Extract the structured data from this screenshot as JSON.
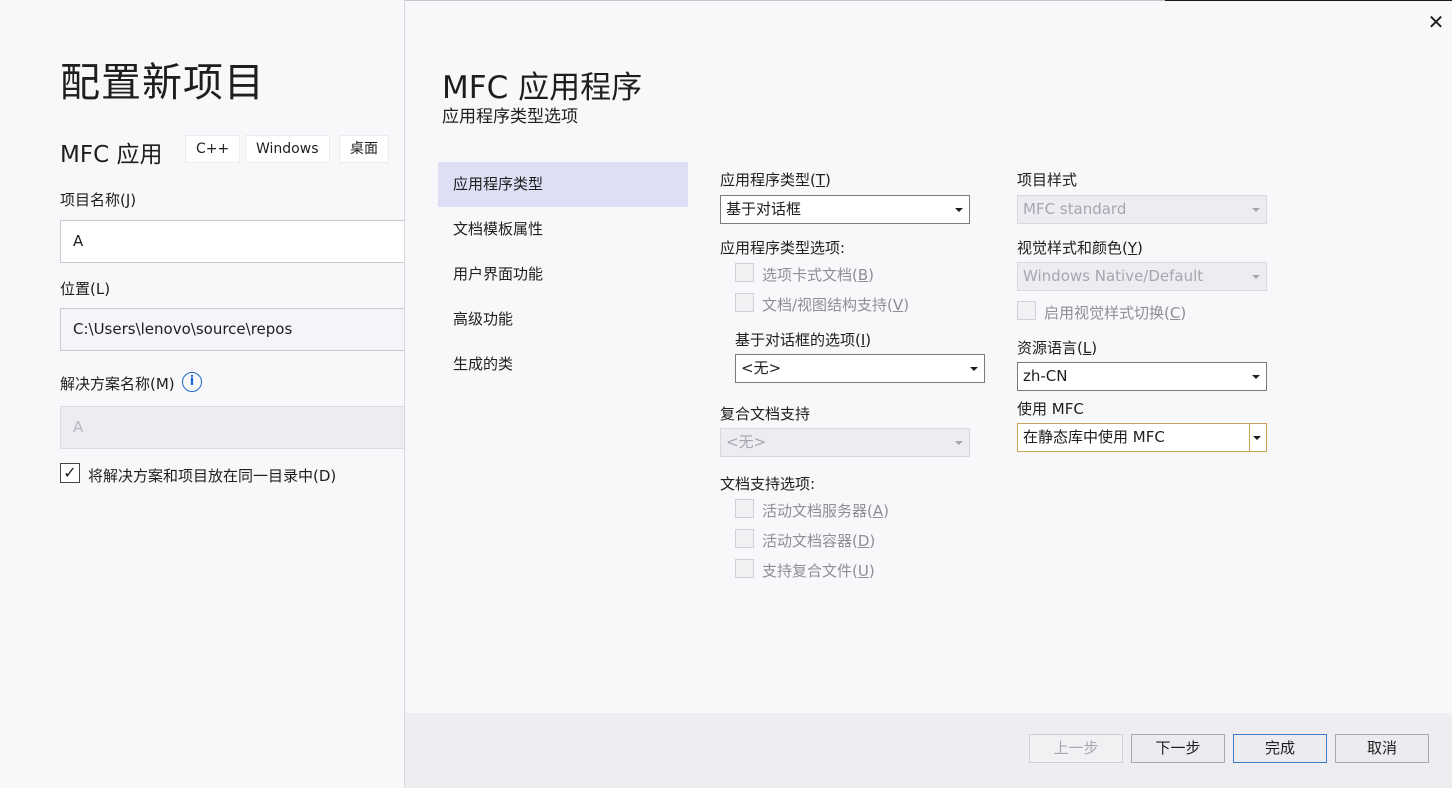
{
  "background": {
    "title": "配置新项目",
    "template_name": "MFC 应用",
    "tags": [
      "C++",
      "Windows",
      "桌面"
    ],
    "project_name_label": "项目名称(J)",
    "project_name_value": "A",
    "location_label": "位置(L)",
    "location_value": "C:\\Users\\lenovo\\source\\repos",
    "solution_name_label": "解决方案名称(M)",
    "solution_name_value": "A",
    "same_dir_label": "将解决方案和项目放在同一目录中(D)",
    "same_dir_checked": "✓"
  },
  "dialog": {
    "title": "MFC 应用程序",
    "subtitle": "应用程序类型选项",
    "close_glyph": "✕",
    "nav": [
      "应用程序类型",
      "文档模板属性",
      "用户界面功能",
      "高级功能",
      "生成的类"
    ],
    "app_type_label": "应用程序类型(T)",
    "app_type_value": "基于对话框",
    "app_type_options_label": "应用程序类型选项:",
    "tabbed_docs_label": "选项卡式文档(B)",
    "doc_view_label": "文档/视图结构支持(V)",
    "dialog_options_label": "基于对话框的选项(I)",
    "dialog_options_value": "<无>",
    "compound_doc_label": "复合文档支持",
    "compound_doc_value": "<无>",
    "doc_support_label": "文档支持选项:",
    "active_doc_server_label": "活动文档服务器(A)",
    "active_doc_container_label": "活动文档容器(D)",
    "compound_file_label": "支持复合文件(U)",
    "project_style_label": "项目样式",
    "project_style_value": "MFC standard",
    "visual_style_label": "视觉样式和颜色(Y)",
    "visual_style_value": "Windows Native/Default",
    "enable_visual_switch_label": "启用视觉样式切换(C)",
    "resource_lang_label": "资源语言(L)",
    "resource_lang_value": "zh-CN",
    "use_mfc_label": "使用 MFC",
    "use_mfc_value": "在静态库中使用 MFC"
  },
  "footer": {
    "prev": "上一步",
    "next": "下一步",
    "finish": "完成",
    "cancel": "取消"
  }
}
